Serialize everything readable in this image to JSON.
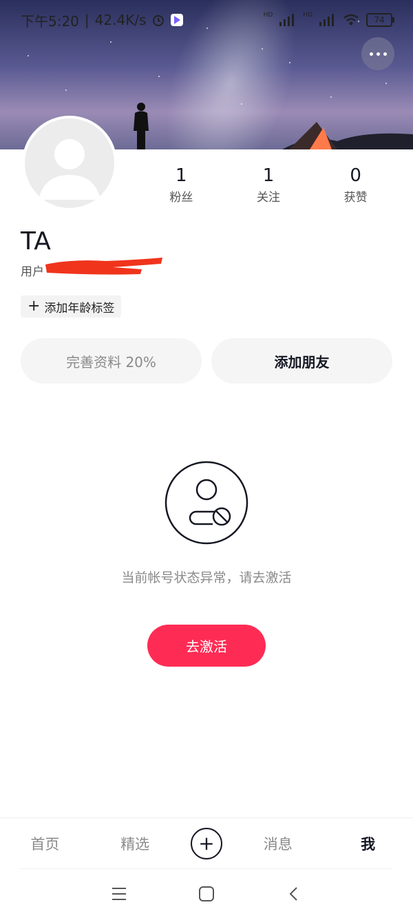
{
  "status_bar": {
    "time": "下午5:20",
    "separator": "|",
    "net_speed": "42.4K/s",
    "signal1_label": "HD",
    "signal2_label": "HD",
    "battery": "74"
  },
  "profile": {
    "name": "TA",
    "user_id_prefix": "用户",
    "age_tag_icon": "plus-icon",
    "age_tag": "添加年龄标签"
  },
  "stats": [
    {
      "value": "1",
      "label": "粉丝"
    },
    {
      "value": "1",
      "label": "关注"
    },
    {
      "value": "0",
      "label": "获赞"
    }
  ],
  "actions": {
    "complete_profile": "完善资料 20%",
    "add_friend": "添加朋友"
  },
  "empty_state": {
    "icon": "user-blocked-icon",
    "message": "当前帐号状态异常，请去激活",
    "button": "去激活"
  },
  "tabbar": {
    "items": [
      "首页",
      "精选",
      "消息",
      "我"
    ],
    "active": "我"
  },
  "colors": {
    "accent": "#fe2c55",
    "text_primary": "#161823",
    "text_secondary": "#8a8a8a"
  }
}
